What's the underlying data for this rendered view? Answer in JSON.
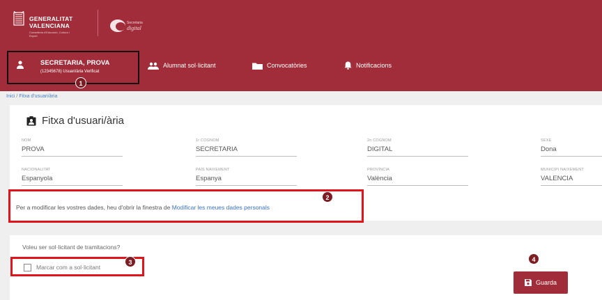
{
  "header": {
    "org_line1": "GENERALITAT",
    "org_line2": "VALENCIANA",
    "org_sub": "Conselleria d'Educació, Cultura i Esport",
    "app_logo_small": "Secretaria",
    "app_logo_script": "digital"
  },
  "user": {
    "name": "SECRETARIA, PROVA",
    "detail": "(12345678) Usuari/ària Verificat"
  },
  "nav": [
    {
      "label": "Alumnat sol·licitant"
    },
    {
      "label": "Convocatòries"
    },
    {
      "label": "Notificacions"
    }
  ],
  "breadcrumb": {
    "home": "Inici",
    "separator": "/",
    "current": "Fitxa d'usuari/ària"
  },
  "card": {
    "title": "Fitxa d'usuari/ària",
    "fields": [
      {
        "label": "NOM",
        "value": "PROVA"
      },
      {
        "label": "1r COGNOM",
        "value": "SECRETARIA"
      },
      {
        "label": "2n COGNOM",
        "value": "DIGITAL"
      },
      {
        "label": "SEXE",
        "value": "Dona"
      },
      {
        "label": "NACIONALITAT",
        "value": "Espanyola"
      },
      {
        "label": "PAÍS NAIXEMENT",
        "value": "Espanya"
      },
      {
        "label": "PROVÍNCIA",
        "value": "València"
      },
      {
        "label": "MUNICIPI NAIXEMENT",
        "value": "VALENCIA"
      }
    ],
    "info_text": "Per a modificar les vostres dades, heu d'obrir la finestra de ",
    "info_link": "Modificar les meues dades personals"
  },
  "requester": {
    "question": "Voleu ser sol·licitant de tramitacions?",
    "checkbox_label": "Marcar com a sol·licitant",
    "checked": false
  },
  "save_label": "Guarda",
  "badges": {
    "b1": "1",
    "b2": "2",
    "b3": "3",
    "b4": "4"
  },
  "colors": {
    "brand": "#a12d3a",
    "highlight": "#e0141a",
    "link": "#3a73c4"
  }
}
